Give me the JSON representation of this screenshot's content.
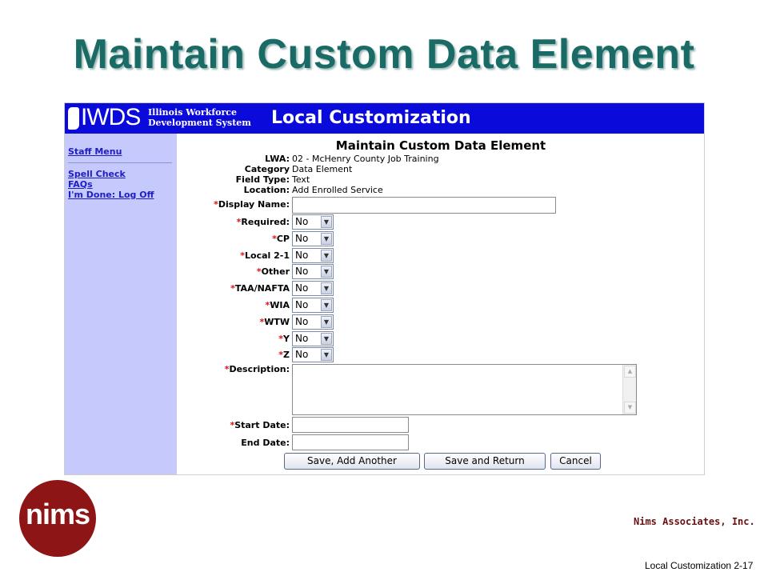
{
  "slide": {
    "title": "Maintain Custom Data Element",
    "company": "Nims Associates, Inc.",
    "footer": "Local Customization 2-17",
    "logo_text": "nims"
  },
  "header": {
    "logo_text": "IWDS",
    "logo_sub_line1": "Illinois Workforce",
    "logo_sub_line2": "Development System",
    "app_title": "Local Customization",
    "color": "#0a0adb"
  },
  "sidebar": {
    "items": [
      {
        "label": "Staff Menu"
      },
      {
        "label": "Spell Check"
      },
      {
        "label": "FAQs"
      },
      {
        "label": "I'm Done: Log Off"
      }
    ]
  },
  "form": {
    "title": "Maintain Custom Data Element",
    "info": [
      {
        "label": "LWA:",
        "value": "02 - McHenry County Job Training"
      },
      {
        "label": "Category",
        "value": "Data Element"
      },
      {
        "label": "Field Type:",
        "value": "Text"
      },
      {
        "label": "Location:",
        "value": "Add Enrolled Service"
      }
    ],
    "display_name": {
      "label": "Display Name:",
      "value": ""
    },
    "selects": [
      {
        "label": "Required:",
        "value": "No"
      },
      {
        "label": "CP",
        "value": "No"
      },
      {
        "label": "Local 2-1",
        "value": "No"
      },
      {
        "label": "Other",
        "value": "No"
      },
      {
        "label": "TAA/NAFTA",
        "value": "No"
      },
      {
        "label": "WIA",
        "value": "No"
      },
      {
        "label": "WTW",
        "value": "No"
      },
      {
        "label": "Y",
        "value": "No"
      },
      {
        "label": "Z",
        "value": "No"
      }
    ],
    "description": {
      "label": "Description:",
      "value": ""
    },
    "start_date": {
      "label": "Start Date:",
      "value": ""
    },
    "end_date": {
      "label": "End Date:",
      "value": ""
    },
    "required_marker": "*",
    "buttons": {
      "save_add": "Save, Add Another",
      "save_return": "Save and Return",
      "cancel": "Cancel"
    }
  },
  "colors": {
    "title": "#1a6b66",
    "required": "#e01010",
    "sidebar_bg": "#c5c9fb",
    "logo": "#8e1515"
  }
}
